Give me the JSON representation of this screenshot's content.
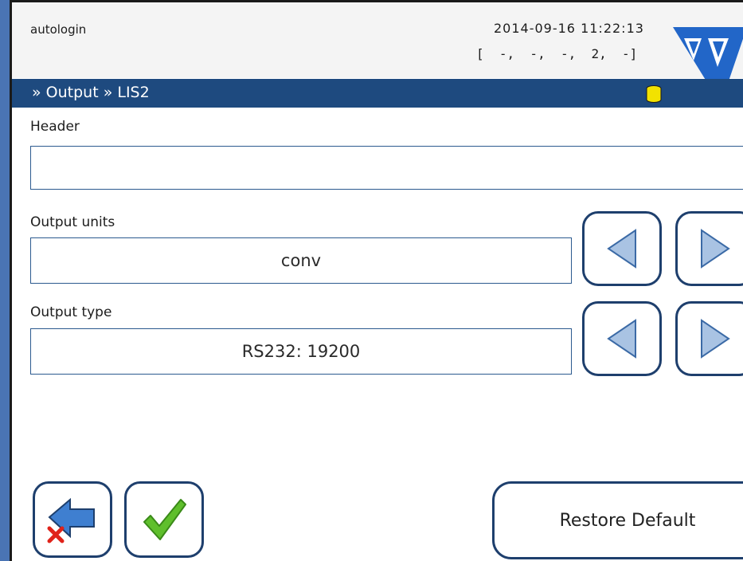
{
  "status_bar": {
    "user": "autologin",
    "datetime": "2014-09-16 11:22:13",
    "counters": "[  -,  -,  -,  2,  -]"
  },
  "breadcrumb": "» Output » LIS2",
  "fields": {
    "header": {
      "label": "Header",
      "value": ""
    },
    "output_units": {
      "label": "Output units",
      "value": "conv"
    },
    "output_type": {
      "label": "Output type",
      "value": "RS232: 19200"
    }
  },
  "buttons": {
    "restore_default": "Restore Default"
  },
  "colors": {
    "title_bar": "#1e4a7f",
    "button_border": "#1e3f6d",
    "logo": "#2266c8",
    "check": "#5fbf2c",
    "cancel_x": "#e0231a"
  },
  "icons": [
    "logo-icon",
    "database-icon",
    "arrow-left-icon",
    "arrow-right-icon",
    "back-arrow-icon",
    "cancel-x-icon",
    "checkmark-icon"
  ]
}
